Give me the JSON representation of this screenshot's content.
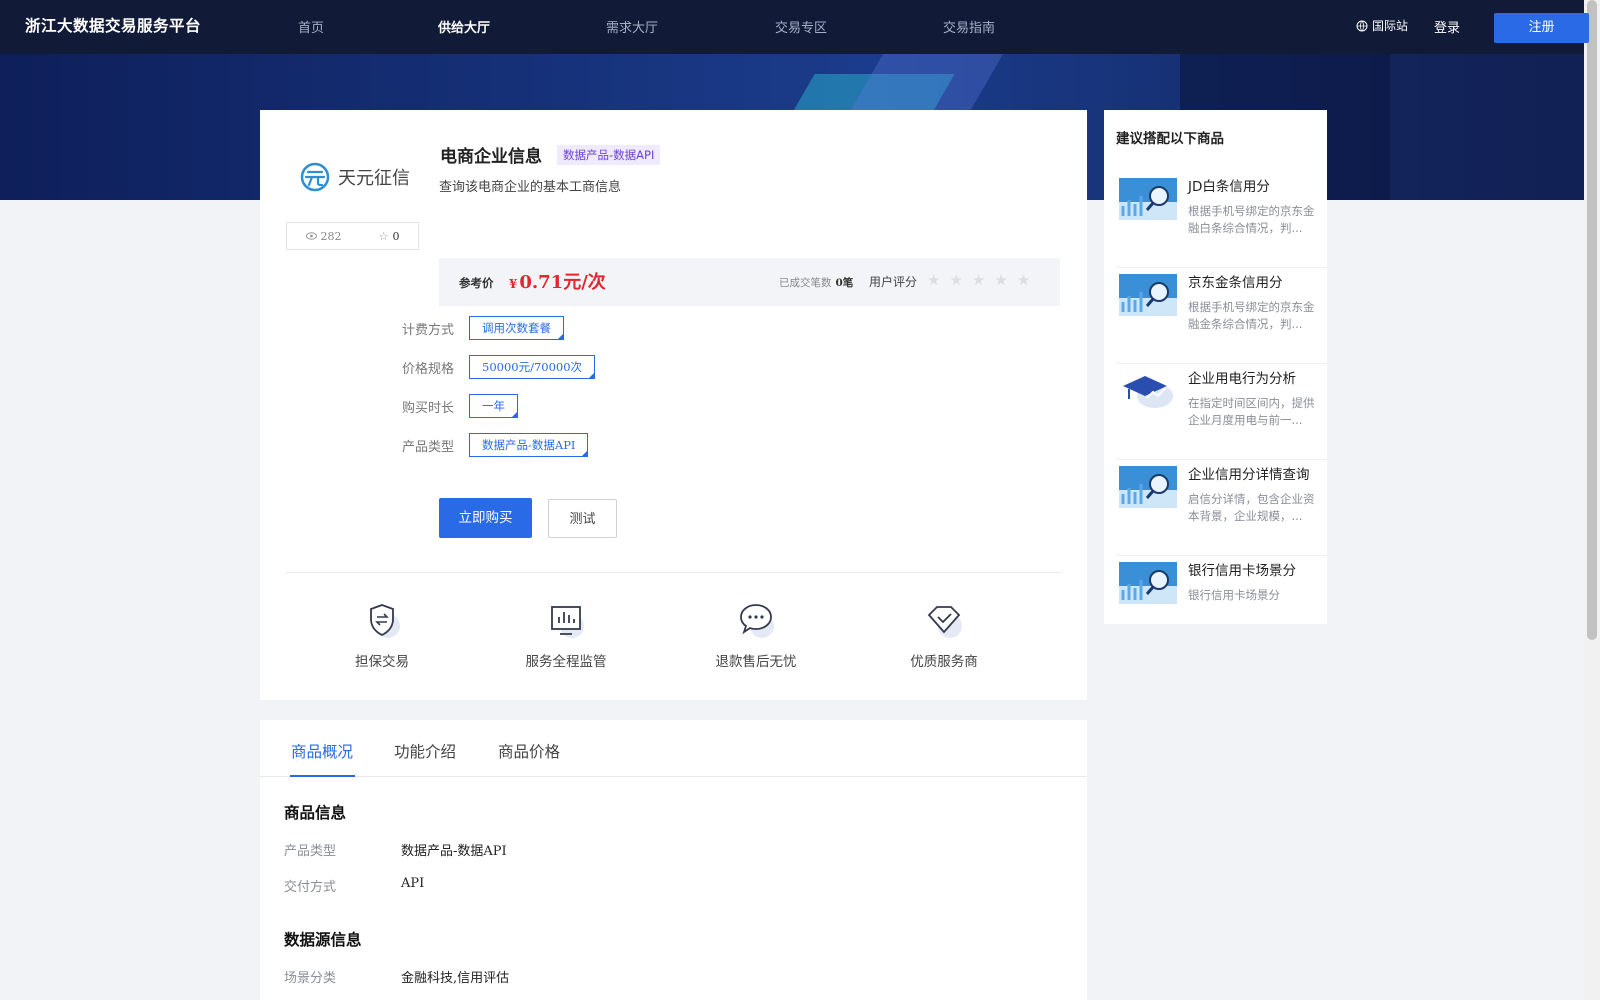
{
  "header": {
    "site_title": "浙江大数据交易服务平台",
    "nav": [
      {
        "label": "首页",
        "active": false
      },
      {
        "label": "供给大厅",
        "active": true
      },
      {
        "label": "需求大厅",
        "active": false
      },
      {
        "label": "交易专区",
        "active": false
      },
      {
        "label": "交易指南",
        "active": false
      }
    ],
    "intl_label": "国际站",
    "login_label": "登录",
    "register_label": "注册"
  },
  "product": {
    "brand_name": "天元征信",
    "views": "282",
    "favorites": "0",
    "title": "电商企业信息",
    "tag": "数据产品-数据API",
    "description": "查询该电商企业的基本工商信息",
    "price_label": "参考价",
    "price_symbol": "¥",
    "price": "0.71元/次",
    "trade_count_label": "已成交笔数",
    "trade_count": "0笔",
    "rating_label": "用户评分",
    "rating": 0,
    "rating_max": 5,
    "specs": [
      {
        "label": "计费方式",
        "value": "调用次数套餐"
      },
      {
        "label": "价格规格",
        "value": "50000元/70000次"
      },
      {
        "label": "购买时长",
        "value": "一年"
      },
      {
        "label": "产品类型",
        "value": "数据产品-数据API"
      }
    ],
    "buy_label": "立即购买",
    "test_label": "测试",
    "features": [
      {
        "icon": "shield-exchange-icon",
        "label": "担保交易"
      },
      {
        "icon": "monitor-chart-icon",
        "label": "服务全程监管"
      },
      {
        "icon": "chat-bubble-icon",
        "label": "退款售后无忧"
      },
      {
        "icon": "diamond-check-icon",
        "label": "优质服务商"
      }
    ]
  },
  "recommend": {
    "title": "建议搭配以下商品",
    "items": [
      {
        "name": "JD白条信用分",
        "desc": "根据手机号绑定的京东金融白条综合情况，判...",
        "thumb": "magnifier-chart-thumb"
      },
      {
        "name": "京东金条信用分",
        "desc": "根据手机号绑定的京东金融金条综合情况，判...",
        "thumb": "magnifier-chart-thumb"
      },
      {
        "name": "企业用电行为分析",
        "desc": "在指定时间区间内，提供企业月度用电与前一...",
        "thumb": "graduation-chart-thumb"
      },
      {
        "name": "企业信用分详情查询",
        "desc": "启信分详情，包含企业资本背景，企业规模，...",
        "thumb": "magnifier-chart-thumb"
      },
      {
        "name": "银行信用卡场景分",
        "desc": "银行信用卡场景分",
        "thumb": "magnifier-chart-thumb"
      }
    ]
  },
  "details": {
    "tabs": [
      {
        "label": "商品概况",
        "active": true
      },
      {
        "label": "功能介绍",
        "active": false
      },
      {
        "label": "商品价格",
        "active": false
      }
    ],
    "product_info_title": "商品信息",
    "product_info": [
      {
        "key": "产品类型",
        "value": "数据产品-数据API"
      },
      {
        "key": "交付方式",
        "value": "API"
      }
    ],
    "source_info_title": "数据源信息",
    "source_info": [
      {
        "key": "场景分类",
        "value": "金融科技,信用评估"
      }
    ]
  },
  "colors": {
    "primary": "#2a6ae6",
    "price": "#e0262e",
    "header_bg": "#111a36"
  }
}
